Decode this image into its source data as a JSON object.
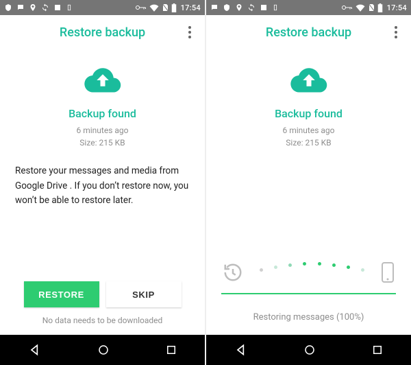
{
  "accent": "#1abc9c",
  "accent_alt": "#2ecc71",
  "status": {
    "clock": "17:54"
  },
  "left": {
    "app_title": "Restore backup",
    "found_title": "Backup found",
    "timestamp": "6 minutes ago",
    "size": "Size: 215 KB",
    "description": "Restore your messages and media from Google Drive . If you don’t restore now, you won’t be able to restore later.",
    "restore_btn": "RESTORE",
    "skip_btn": "SKIP",
    "footer": "No data needs to be downloaded"
  },
  "right": {
    "app_title": "Restore backup",
    "found_title": "Backup found",
    "timestamp": "6 minutes ago",
    "size": "Size: 215 KB",
    "progress_text": "Restoring messages (100%)"
  }
}
